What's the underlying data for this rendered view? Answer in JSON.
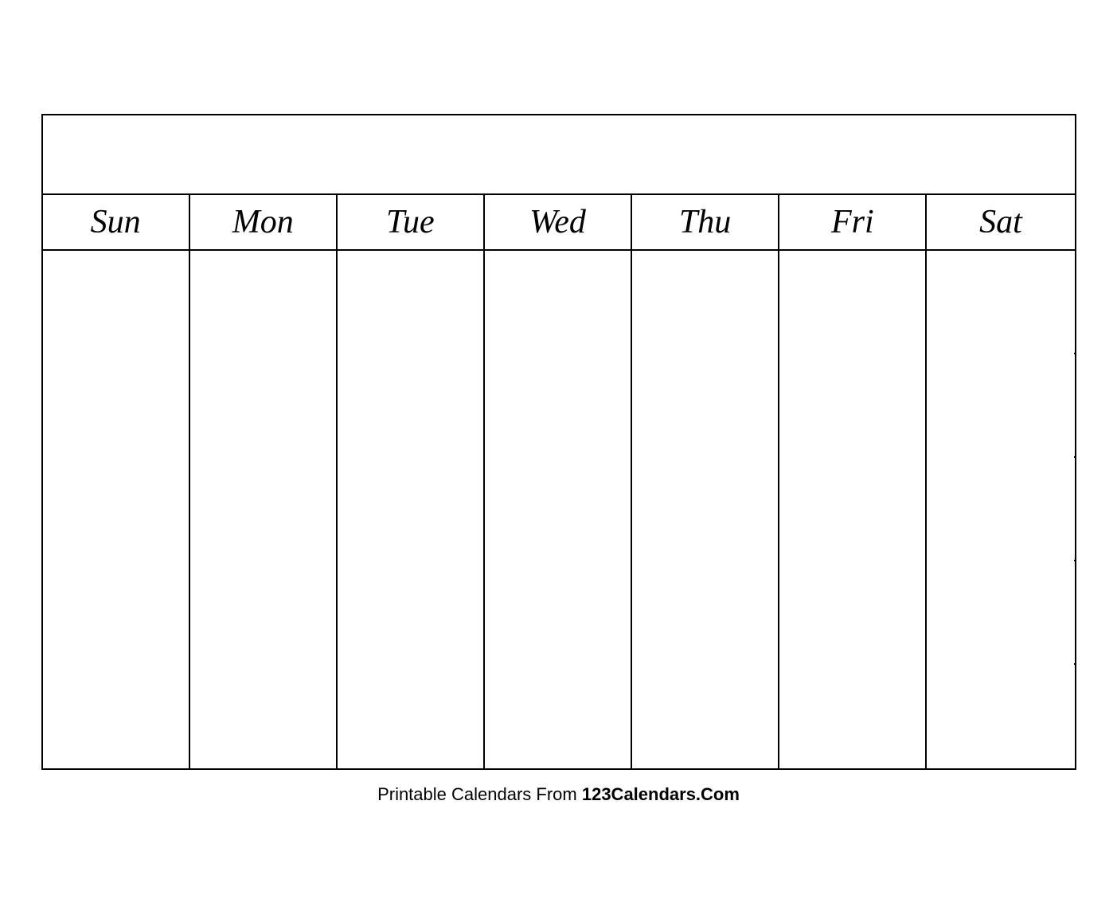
{
  "calendar": {
    "title": "",
    "days": [
      "Sun",
      "Mon",
      "Tue",
      "Wed",
      "Thu",
      "Fri",
      "Sat"
    ],
    "rows": 5
  },
  "footer": {
    "text_normal": "Printable Calendars From ",
    "text_bold": "123Calendars.Com"
  }
}
